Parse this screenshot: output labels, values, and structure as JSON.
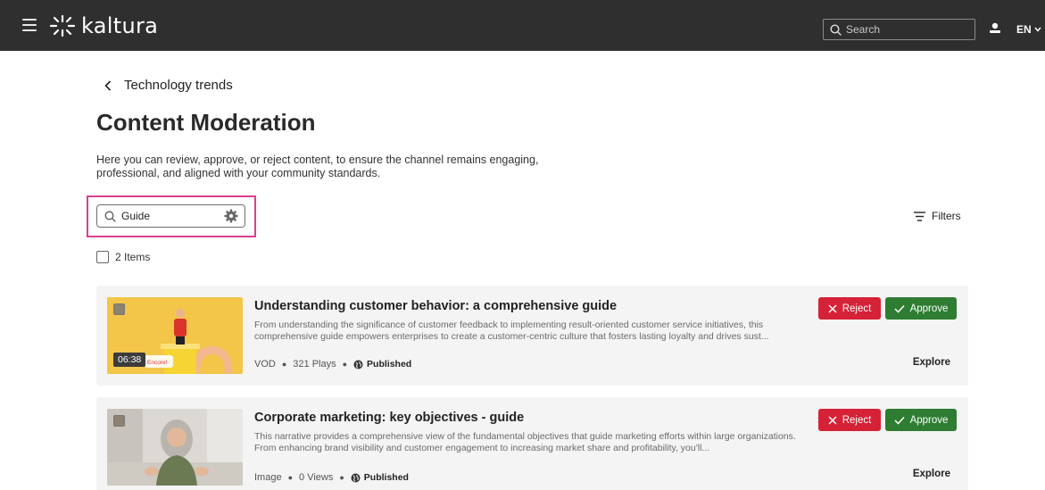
{
  "header": {
    "brand": "kaltura",
    "search_placeholder": "Search",
    "language": "EN",
    "icons": [
      "menu-icon",
      "kaltura-logo-icon",
      "search-icon",
      "user-icon",
      "chevron-down-icon"
    ],
    "bar_color": "#2f2f2f"
  },
  "breadcrumb": {
    "label": "Technology trends"
  },
  "page": {
    "title": "Content Moderation",
    "description": "Here you can review, approve, or reject content, to ensure the channel remains engaging, professional, and aligned with your community standards."
  },
  "search": {
    "value": "Guide"
  },
  "filters": {
    "label": "Filters"
  },
  "selection": {
    "count_label": "2 Items"
  },
  "actions": {
    "reject_label": "Reject",
    "approve_label": "Approve",
    "explore_label": "Explore",
    "reject_color": "#d52237",
    "approve_color": "#2e7d32"
  },
  "entries": [
    {
      "title": "Understanding customer behavior: a comprehensive guide",
      "description": "From understanding the significance of customer feedback to implementing result-oriented customer service initiatives, this comprehensive guide empowers enterprises to create a customer-centric culture that fosters lasting loyalty and drives sust...",
      "type": "VOD",
      "stat": "321 Plays",
      "status": "Published",
      "duration": "06:38",
      "thumb_badge": "Encore!"
    },
    {
      "title": "Corporate marketing: key objectives - guide",
      "description": "This narrative provides a comprehensive view of the fundamental objectives that guide marketing efforts within large organizations. From enhancing brand visibility and customer engagement to increasing market share and profitability, you'll...",
      "type": "Image",
      "stat": "0 Views",
      "status": "Published"
    }
  ]
}
